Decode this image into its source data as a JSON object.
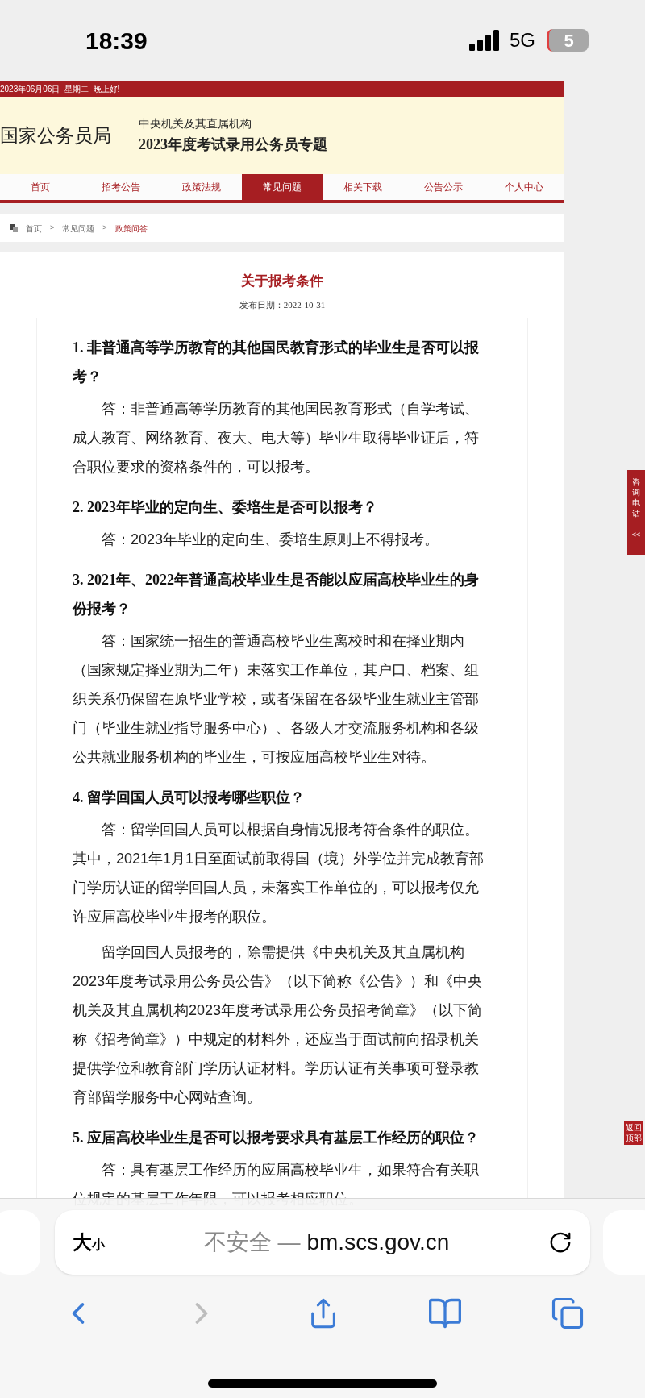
{
  "status_bar": {
    "time": "18:39",
    "network": "5G",
    "battery": "5"
  },
  "header": {
    "date_line": "2023年06月06日  星期二  晚上好!",
    "logo": "国家公务员局",
    "subtitle": "中央机关及其直属机构",
    "title": "2023年度考试录用公务员专题"
  },
  "nav": [
    {
      "label": "首页",
      "selected": false
    },
    {
      "label": "招考公告",
      "selected": false
    },
    {
      "label": "政策法规",
      "selected": false
    },
    {
      "label": "常见问题",
      "selected": true
    },
    {
      "label": "相关下载",
      "selected": false
    },
    {
      "label": "公告公示",
      "selected": false
    },
    {
      "label": "个人中心",
      "selected": false
    }
  ],
  "breadcrumb_separator": ">",
  "breadcrumb": [
    {
      "label": "首页",
      "selected": false
    },
    {
      "label": "常见问题",
      "selected": false
    },
    {
      "label": "政策问答",
      "selected": true
    }
  ],
  "article": {
    "title": "关于报考条件",
    "date": "发布日期：2022-10-31",
    "items": [
      {
        "kind": "question",
        "text": "1. 非普通高等学历教育的其他国民教育形式的毕业生是否可以报考？"
      },
      {
        "kind": "answer",
        "text": "答：非普通高等学历教育的其他国民教育形式（自学考试、成人教育、网络教育、夜大、电大等）毕业生取得毕业证后，符合职位要求的资格条件的，可以报考。"
      },
      {
        "kind": "question",
        "text": "2. 2023年毕业的定向生、委培生是否可以报考？"
      },
      {
        "kind": "answer",
        "text": "答：2023年毕业的定向生、委培生原则上不得报考。"
      },
      {
        "kind": "question",
        "text": "3. 2021年、2022年普通高校毕业生是否能以应届高校毕业生的身份报考？"
      },
      {
        "kind": "answer",
        "text": "答：国家统一招生的普通高校毕业生离校时和在择业期内（国家规定择业期为二年）未落实工作单位，其户口、档案、组织关系仍保留在原毕业学校，或者保留在各级毕业生就业主管部门（毕业生就业指导服务中心）、各级人才交流服务机构和各级公共就业服务机构的毕业生，可按应届高校毕业生对待。"
      },
      {
        "kind": "question",
        "text": "4. 留学回国人员可以报考哪些职位？"
      },
      {
        "kind": "answer",
        "text": "答：留学回国人员可以根据自身情况报考符合条件的职位。其中，2021年1月1日至面试前取得国（境）外学位并完成教育部门学历认证的留学回国人员，未落实工作单位的，可以报考仅允许应届高校毕业生报考的职位。"
      },
      {
        "kind": "answer",
        "text": "留学回国人员报考的，除需提供《中央机关及其直属机构2023年度考试录用公务员公告》（以下简称《公告》）和《中央机关及其直属机构2023年度考试录用公务员招考简章》（以下简称《招考简章》）中规定的材料外，还应当于面试前向招录机关提供学位和教育部门学历认证材料。学历认证有关事项可登录教育部留学服务中心网站查询。"
      },
      {
        "kind": "question",
        "text": "5. 应届高校毕业生是否可以报考要求具有基层工作经历的职位？"
      },
      {
        "kind": "answer",
        "text": "答：具有基层工作经历的应届高校毕业生，如果符合有关职位规定的基层工作年限，可以报考相应职位。"
      }
    ]
  },
  "side_tabs": {
    "consult": "咨询电话",
    "consult_arrow": "<<",
    "back_to_top": "返回顶部"
  },
  "browser": {
    "text_size_large": "大",
    "text_size_small": "小",
    "security": "不安全 —",
    "domain": "bm.scs.gov.cn"
  }
}
